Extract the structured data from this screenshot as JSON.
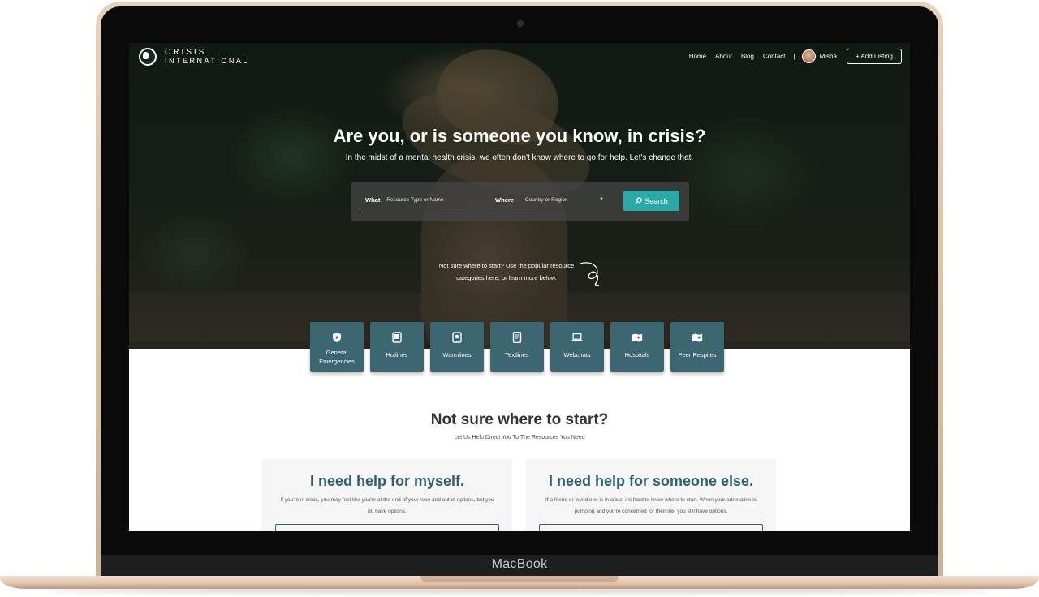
{
  "device": {
    "brand_label": "MacBook"
  },
  "nav": {
    "logo_line1": "CRISIS",
    "logo_line2": "INTERNATIONAL",
    "links": [
      "Home",
      "About",
      "Blog",
      "Contact"
    ],
    "separator": "|",
    "user_name": "Misha",
    "add_listing": "+ Add Listing"
  },
  "hero": {
    "title": "Are you, or is someone you know, in crisis?",
    "subtitle": "In the midst of a mental health crisis, we often don't know where to go for help. Let's change that.",
    "search": {
      "what_label": "What",
      "what_placeholder": "Resource Type or Name",
      "where_label": "Where",
      "where_value": "Country or Region",
      "button_label": "Search"
    },
    "hint": "Not sure where to start? Use the popular resource categories here, or learn more below."
  },
  "categories": [
    {
      "label": "General Emergencies",
      "icon": "shield-star-icon"
    },
    {
      "label": "Hotlines",
      "icon": "phone-icon"
    },
    {
      "label": "Warmlines",
      "icon": "phone-icon"
    },
    {
      "label": "Textlines",
      "icon": "mobile-icon"
    },
    {
      "label": "Webchats",
      "icon": "laptop-icon"
    },
    {
      "label": "Hospitals",
      "icon": "map-icon"
    },
    {
      "label": "Peer Respites",
      "icon": "map-icon"
    }
  ],
  "start_section": {
    "title": "Not sure where to start?",
    "subtitle": "Let Us Help Direct You To The Resources You Need",
    "cards": [
      {
        "title": "I need help for myself.",
        "body": "If you're in crisis, you may feel like you're at the end of your rope and out of options, but you do have options."
      },
      {
        "title": "I need help for someone else.",
        "body": "If a friend or loved one is in crisis, it's hard to know where to start. When your adrenaline is pumping and you're concerned for their life, you still have options."
      }
    ]
  },
  "colors": {
    "accent": "#2aa9a8",
    "category_tile": "#3b6672",
    "card_title": "#2d6170"
  }
}
